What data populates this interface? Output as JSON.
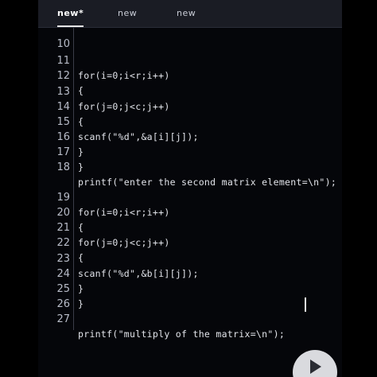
{
  "tabs": [
    {
      "label": "new*"
    },
    {
      "label": "new"
    },
    {
      "label": "new"
    }
  ],
  "lines": [
    {
      "num": "10",
      "code": ""
    },
    {
      "num": "11",
      "code": "for(i=0;i<r;i++)"
    },
    {
      "num": "12",
      "code": "{"
    },
    {
      "num": "13",
      "code": "for(j=0;j<c;j++)"
    },
    {
      "num": "14",
      "code": "{"
    },
    {
      "num": "15",
      "code": "scanf(\"%d\",&a[i][j]);"
    },
    {
      "num": "16",
      "code": "}"
    },
    {
      "num": "17",
      "code": "}"
    },
    {
      "num": "18",
      "code": "printf(\"enter the second matrix element=\\n\");"
    },
    {
      "num": "19",
      "code": "for(i=0;i<r;i++)"
    },
    {
      "num": "20",
      "code": "{"
    },
    {
      "num": "21",
      "code": "for(j=0;j<c;j++)"
    },
    {
      "num": "22",
      "code": "{"
    },
    {
      "num": "23",
      "code": "scanf(\"%d\",&b[i][j]);"
    },
    {
      "num": "24",
      "code": "}"
    },
    {
      "num": "25",
      "code": "}"
    },
    {
      "num": "26",
      "code": ""
    },
    {
      "num": "27",
      "code": "printf(\"multiply of the matrix=\\n\");"
    }
  ],
  "run_button": {
    "icon": "play-icon"
  }
}
